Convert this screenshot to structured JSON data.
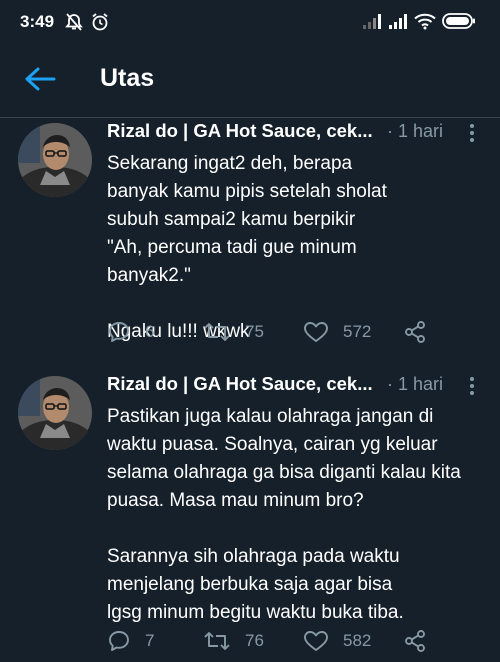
{
  "status_bar": {
    "time": "3:49",
    "icons": [
      "notifications-off-icon",
      "alarm-icon",
      "signal-icon",
      "signal-icon",
      "wifi-icon",
      "battery-icon"
    ]
  },
  "header": {
    "title": "Utas",
    "back_icon": "arrow-left-icon"
  },
  "tweets": [
    {
      "author": "Rizal do | GA Hot Sauce, cek...",
      "time": "· 1 hari",
      "paragraphs": [
        "Sekarang ingat2 deh, berapa banyak kamu pipis setelah sholat subuh sampai2 kamu berpikir \"Ah, percuma tadi gue minum banyak2.\"",
        "Ngaku lu!!! wkwk"
      ],
      "replies": "6",
      "retweets": "75",
      "likes": "572"
    },
    {
      "author": "Rizal do | GA Hot Sauce, cek...",
      "time": "· 1 hari",
      "paragraphs": [
        "Pastikan juga kalau olahraga jangan di waktu puasa. Soalnya, cairan yg keluar selama olahraga ga bisa diganti kalau kita puasa. Masa mau minum bro?",
        "Sarannya sih olahraga pada waktu menjelang berbuka saja agar bisa lgsg minum begitu waktu buka tiba."
      ],
      "replies": "7",
      "retweets": "76",
      "likes": "582"
    }
  ],
  "colors": {
    "background": "#15202b",
    "accent": "#1da1f2",
    "secondary_text": "#8899a6",
    "divider": "#38444d"
  }
}
